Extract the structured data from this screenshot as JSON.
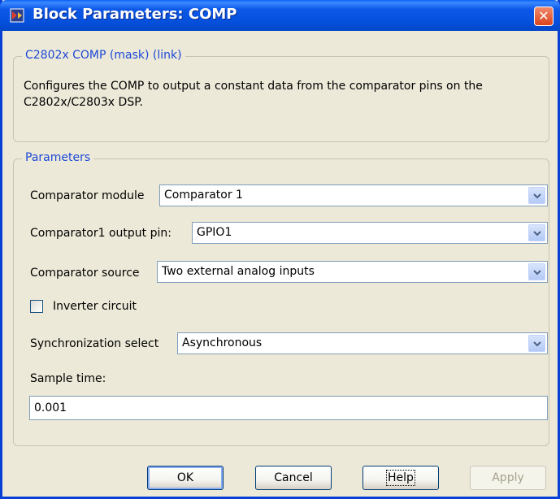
{
  "window": {
    "title": "Block Parameters: COMP",
    "close_glyph": "✕"
  },
  "description_group": {
    "legend": "C2802x COMP (mask) (link)",
    "text": "Configures the COMP to output a constant data from the comparator pins on the C2802x/C2803x DSP."
  },
  "parameters": {
    "legend": "Parameters",
    "comparator_module": {
      "label": "Comparator module",
      "value": "Comparator 1"
    },
    "output_pin": {
      "label": "Comparator1 output pin:",
      "value": "GPIO1"
    },
    "comparator_source": {
      "label": "Comparator source",
      "value": "Two external analog inputs"
    },
    "inverter_circuit": {
      "label": "Inverter circuit",
      "checked": false
    },
    "sync_select": {
      "label": "Synchronization select",
      "value": "Asynchronous"
    },
    "sample_time": {
      "label": "Sample time:",
      "value": "0.001"
    }
  },
  "buttons": {
    "ok": "OK",
    "cancel": "Cancel",
    "help": "Help",
    "apply": "Apply"
  },
  "colors": {
    "title_bar": "#0550dc",
    "legend_text": "#1c48d8",
    "dialog_bg": "#ece9d8",
    "close_button": "#d9431c"
  }
}
